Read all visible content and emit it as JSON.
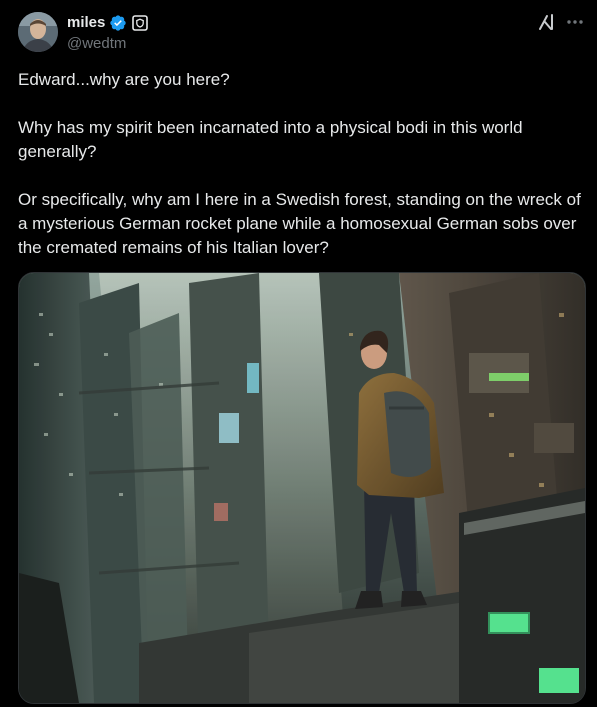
{
  "tweet": {
    "author": {
      "display_name": "miles",
      "handle": "@wedtm",
      "verified": true
    },
    "text": "Edward...why are you here?\n\nWhy has my spirit been incarnated into a physical bodi in this world generally?\n\nOr specifically, why am I here in a Swedish forest, standing on the wreck of a mysterious German rocket plane while a homosexual German sobs over the cremated remains of his Italian lover?",
    "media": {
      "type": "image"
    }
  },
  "icons": {
    "verified": "verified-badge-icon",
    "affiliate": "affiliate-badge-icon",
    "grok": "grok-icon",
    "more": "more-options-icon"
  },
  "colors": {
    "background": "#000000",
    "text_primary": "#e7e9ea",
    "text_secondary": "#71767b",
    "verified_blue": "#1d9bf0",
    "border": "#2f3336"
  }
}
